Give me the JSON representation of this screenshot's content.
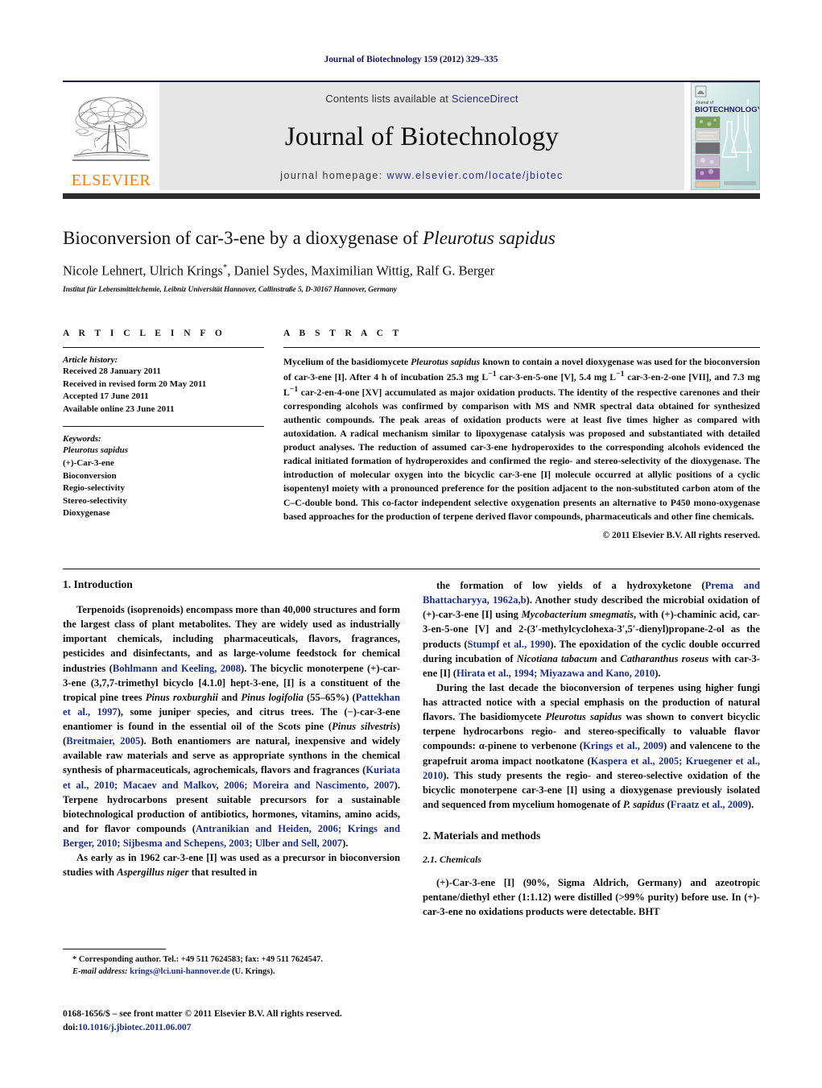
{
  "running_head": "Journal of Biotechnology 159 (2012) 329–335",
  "masthead": {
    "publisher_name": "ELSEVIER",
    "contents_prefix": "Contents lists available at ",
    "contents_link": "ScienceDirect",
    "journal_name": "Journal of Biotechnology",
    "homepage_prefix": "journal homepage: ",
    "homepage_url": "www.elsevier.com/locate/jbiotec",
    "cover": {
      "kicker": "Journal of",
      "title": "BIOTECHNOLOGY"
    },
    "band_bg": "#e6e6e6",
    "link_color": "#2b2b8f",
    "elsevier_orange": "#f08000"
  },
  "article": {
    "title_part1": "Bioconversion of car-3-ene by a dioxygenase of ",
    "title_italic": "Pleurotus sapidus",
    "authors": "Nicole Lehnert, Ulrich Krings",
    "authors_star": "*",
    "authors_rest": ", Daniel Sydes, Maximilian Wittig, Ralf G. Berger",
    "affiliation": "Institut für Lebensmittelchemie, Leibniz Universität Hannover, Callinstraße 5, D-30167 Hannover, Germany"
  },
  "article_info": {
    "label": "A R T I C L E   I N F O",
    "history_title": "Article history:",
    "history": [
      "Received 28 January 2011",
      "Received in revised form 20 May 2011",
      "Accepted 17 June 2011",
      "Available online 23 June 2011"
    ],
    "keywords_title": "Keywords:",
    "keywords": [
      "Pleurotus sapidus",
      "(+)-Car-3-ene",
      "Bioconversion",
      "Regio-selectivity",
      "Stereo-selectivity",
      "Dioxygenase"
    ],
    "keywords_italic_index": 0
  },
  "abstract": {
    "label": "A B S T R A C T",
    "text_segments": [
      {
        "t": "Mycelium of the basidiomycete ",
        "style": "normal"
      },
      {
        "t": "Pleurotus sapidus",
        "style": "italic"
      },
      {
        "t": " known to contain a novel dioxygenase was used for the bioconversion of car-3-ene [I]. After 4 h of incubation 25.3 mg L",
        "style": "normal"
      },
      {
        "t": "−1",
        "style": "sup"
      },
      {
        "t": " car-3-en-5-one [V], 5.4 mg L",
        "style": "normal"
      },
      {
        "t": "−1",
        "style": "sup"
      },
      {
        "t": " car-3-en-2-one [VII], and 7.3 mg L",
        "style": "normal"
      },
      {
        "t": "−1",
        "style": "sup"
      },
      {
        "t": " car-2-en-4-one [XV] accumulated as major oxidation products. The identity of the respective carenones and their corresponding alcohols was confirmed by comparison with MS and NMR spectral data obtained for synthesized authentic compounds. The peak areas of oxidation products were at least five times higher as compared with autoxidation. A radical mechanism similar to lipoxygenase catalysis was proposed and substantiated with detailed product analyses. The reduction of assumed car-3-ene hydroperoxides to the corresponding alcohols evidenced the radical initiated formation of hydroperoxides and confirmed the regio- and stereo-selectivity of the dioxygenase. The introduction of molecular oxygen into the bicyclic car-3-ene [I] molecule occurred at allylic positions of a cyclic isopentenyl moiety with a pronounced preference for the position adjacent to the non-substituted carbon atom of the C–C-double bond. This co-factor independent selective oxygenation presents an alternative to P450 mono-oxygenase based approaches for the production of terpene derived flavor compounds, pharmaceuticals and other fine chemicals.",
        "style": "normal"
      }
    ],
    "copyright": "© 2011 Elsevier B.V. All rights reserved."
  },
  "sections": {
    "introduction_heading": "1.  Introduction",
    "materials_heading": "2.  Materials and methods",
    "chemicals_subheading": "2.1.  Chemicals"
  },
  "body": {
    "left": [
      [
        {
          "t": "Terpenoids (isoprenoids) encompass more than 40,000 structures and form the largest class of plant metabolites. They are widely used as industrially important chemicals, including pharmaceuticals, flavors, fragrances, pesticides and disinfectants, and as large-volume feedstock for chemical industries (",
          "style": "normal"
        },
        {
          "t": "Bohlmann and Keeling, 2008",
          "style": "ref"
        },
        {
          "t": "). The bicyclic monoterpene (+)-car-3-ene (3,7,7-trimethyl bicyclo [4.1.0] hept-3-ene, [I] is a constituent of the tropical pine trees ",
          "style": "normal"
        },
        {
          "t": "Pinus roxburghii",
          "style": "italic"
        },
        {
          "t": " and ",
          "style": "normal"
        },
        {
          "t": "Pinus logifolia",
          "style": "italic"
        },
        {
          "t": " (55–65%) (",
          "style": "normal"
        },
        {
          "t": "Pattekhan et al., 1997",
          "style": "ref"
        },
        {
          "t": "), some juniper species, and citrus trees. The (−)-car-3-ene enantiomer is found in the essential oil of the Scots pine (",
          "style": "normal"
        },
        {
          "t": "Pinus silvestris",
          "style": "italic"
        },
        {
          "t": ") (",
          "style": "normal"
        },
        {
          "t": "Breitmaier, 2005",
          "style": "ref"
        },
        {
          "t": "). Both enantiomers are natural, inexpensive and widely available raw materials and serve as appropriate synthons in the chemical synthesis of pharmaceuticals, agrochemicals, flavors and fragrances (",
          "style": "normal"
        },
        {
          "t": "Kuriata et al., 2010; Macaev and Malkov, 2006; Moreira and Nascimento, 2007",
          "style": "ref"
        },
        {
          "t": "). Terpene hydrocarbons present suitable precursors for a sustainable biotechnological production of antibiotics, hormones, vitamins, amino acids, and for flavor compounds (",
          "style": "normal"
        },
        {
          "t": "Antranikian and Heiden, 2006; Krings and Berger, 2010; Sijbesma and Schepens, 2003; Ulber and Sell, 2007",
          "style": "ref"
        },
        {
          "t": ").",
          "style": "normal"
        }
      ],
      [
        {
          "t": "As early as in 1962 car-3-ene [I] was used as a precursor in bioconversion studies with ",
          "style": "normal"
        },
        {
          "t": "Aspergillus niger",
          "style": "italic"
        },
        {
          "t": " that resulted in",
          "style": "normal"
        }
      ]
    ],
    "right": [
      [
        {
          "t": "the formation of low yields of a hydroxyketone (",
          "style": "normal"
        },
        {
          "t": "Prema and Bhattacharyya, 1962a,b",
          "style": "ref"
        },
        {
          "t": "). Another study described the microbial oxidation of (+)-car-3-ene [I] using ",
          "style": "normal"
        },
        {
          "t": "Mycobacterium smegmatis",
          "style": "italic"
        },
        {
          "t": ", with (+)-chaminic acid, car-3-en-5-one [V] and 2-(3′-methylcyclohexa-3′,5′-dienyl)propane-2-ol as the products (",
          "style": "normal"
        },
        {
          "t": "Stumpf et al., 1990",
          "style": "ref"
        },
        {
          "t": "). The epoxidation of the cyclic double occurred during incubation of ",
          "style": "normal"
        },
        {
          "t": "Nicotiana tabacum",
          "style": "italic"
        },
        {
          "t": " and ",
          "style": "normal"
        },
        {
          "t": "Catharanthus roseus",
          "style": "italic"
        },
        {
          "t": " with car-3-ene [I] (",
          "style": "normal"
        },
        {
          "t": "Hirata et al., 1994; Miyazawa and Kano, 2010",
          "style": "ref"
        },
        {
          "t": ").",
          "style": "normal"
        }
      ],
      [
        {
          "t": "During the last decade the bioconversion of terpenes using higher fungi has attracted notice with a special emphasis on the production of natural flavors. The basidiomycete ",
          "style": "normal"
        },
        {
          "t": "Pleurotus sapidus",
          "style": "italic"
        },
        {
          "t": " was shown to convert bicyclic terpene hydrocarbons regio- and stereo-specifically to valuable flavor compounds: α-pinene to verbenone (",
          "style": "normal"
        },
        {
          "t": "Krings et al., 2009",
          "style": "ref"
        },
        {
          "t": ") and valencene to the grapefruit aroma impact nootkatone (",
          "style": "normal"
        },
        {
          "t": "Kaspera et al., 2005; Kruegener et al., 2010",
          "style": "ref"
        },
        {
          "t": "). This study presents the regio- and stereo-selective oxidation of the bicyclic monoterpene car-3-ene [I] using a dioxygenase previously isolated and sequenced from mycelium homogenate of ",
          "style": "normal"
        },
        {
          "t": "P. sapidus",
          "style": "italic"
        },
        {
          "t": " (",
          "style": "normal"
        },
        {
          "t": "Fraatz et al., 2009",
          "style": "ref"
        },
        {
          "t": ").",
          "style": "normal"
        }
      ],
      [
        {
          "t": "(+)-Car-3-ene [I] (90%, Sigma Aldrich, Germany) and azeotropic pentane/diethyl ether (1:1.12) were distilled (>99% purity) before use. In (+)-car-3-ene no oxidations products were detectable. BHT",
          "style": "normal"
        }
      ]
    ]
  },
  "footnote": {
    "corresponding": "* Corresponding author. Tel.: +49 511 7624583; fax: +49 511 7624547.",
    "email_label": "E-mail address: ",
    "email": "krings@lci.uni-hannover.de",
    "email_suffix": " (U. Krings)."
  },
  "footer": {
    "issn_line": "0168-1656/$ – see front matter © 2011 Elsevier B.V. All rights reserved.",
    "doi_label": "doi:",
    "doi": "10.1016/j.jbiotec.2011.06.007"
  }
}
